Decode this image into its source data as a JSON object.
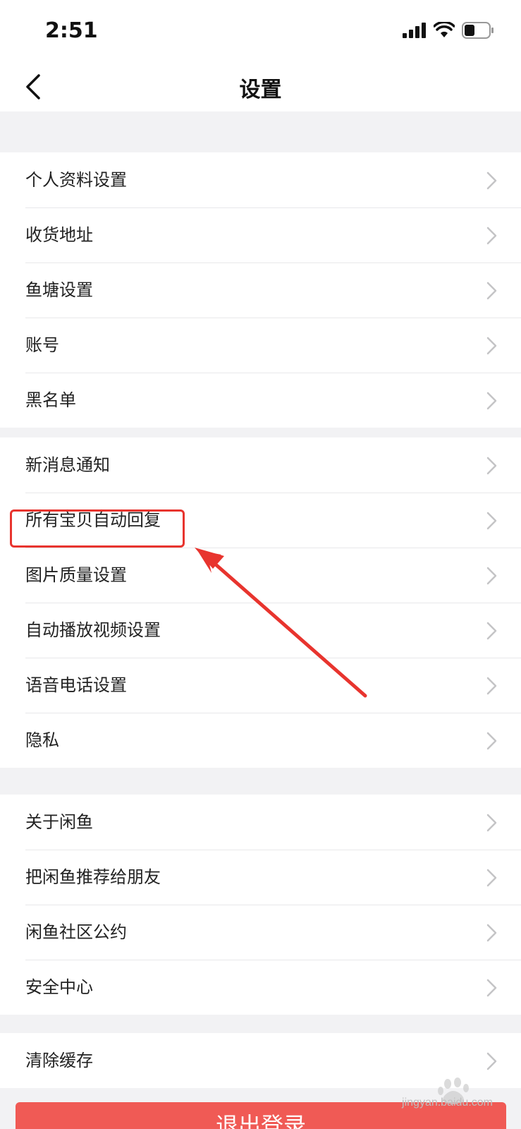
{
  "status_bar": {
    "time": "2:51",
    "icons": [
      "signal-icon",
      "wifi-icon",
      "battery-icon"
    ]
  },
  "nav": {
    "back_icon": "chevron-left-icon",
    "title": "设置"
  },
  "groups": [
    {
      "items": [
        "个人资料设置",
        "收货地址",
        "鱼塘设置",
        "账号",
        "黑名单"
      ]
    },
    {
      "items": [
        "新消息通知",
        "所有宝贝自动回复",
        "图片质量设置",
        "自动播放视频设置",
        "语音电话设置",
        "隐私"
      ]
    },
    {
      "items": [
        "关于闲鱼",
        "把闲鱼推荐给朋友",
        "闲鱼社区公约",
        "安全中心"
      ]
    },
    {
      "items": [
        "清除缓存"
      ]
    }
  ],
  "annotation": {
    "highlighted_item": "所有宝贝自动回复",
    "color": "#e8342e"
  },
  "logout": {
    "label": "退出登录"
  },
  "watermark": {
    "brand": "Baidu",
    "text": "jingyan.baidu.com"
  },
  "colors": {
    "background": "#f2f2f4",
    "logout": "#f05a55",
    "annotation": "#e8342e"
  }
}
